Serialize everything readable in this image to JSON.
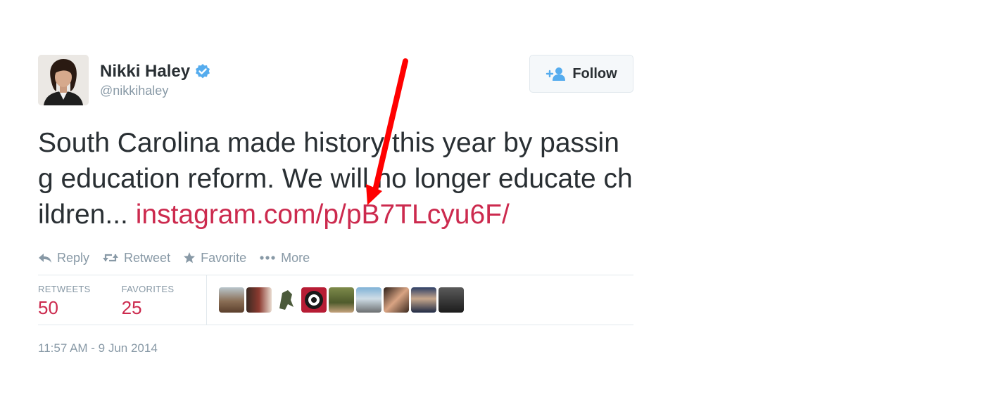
{
  "user": {
    "name": "Nikki Haley",
    "handle": "@nikkihaley",
    "verified_icon": "verified-badge-icon"
  },
  "follow_button": {
    "label": "Follow",
    "icon": "add-user-icon"
  },
  "tweet": {
    "text": "South Carolina made history this year by passing education reform. We will no longer educate children... ",
    "link": "instagram.com/p/pB7TLcyu6F/"
  },
  "actions": [
    {
      "label": "Reply",
      "icon": "reply-icon"
    },
    {
      "label": "Retweet",
      "icon": "retweet-icon"
    },
    {
      "label": "Favorite",
      "icon": "star-icon"
    },
    {
      "label": "More",
      "icon": "more-dots-icon"
    }
  ],
  "stats": {
    "retweets_label": "RETWEETS",
    "retweets": "50",
    "favorites_label": "FAVORITES",
    "favorites": "25"
  },
  "timestamp": "11:57 AM - 9 Jun 2014",
  "colors": {
    "link": "#cc2a4e",
    "text": "#292f33",
    "muted": "#8899a6",
    "verified": "#55acee",
    "annotation_arrow": "#ff0000"
  }
}
